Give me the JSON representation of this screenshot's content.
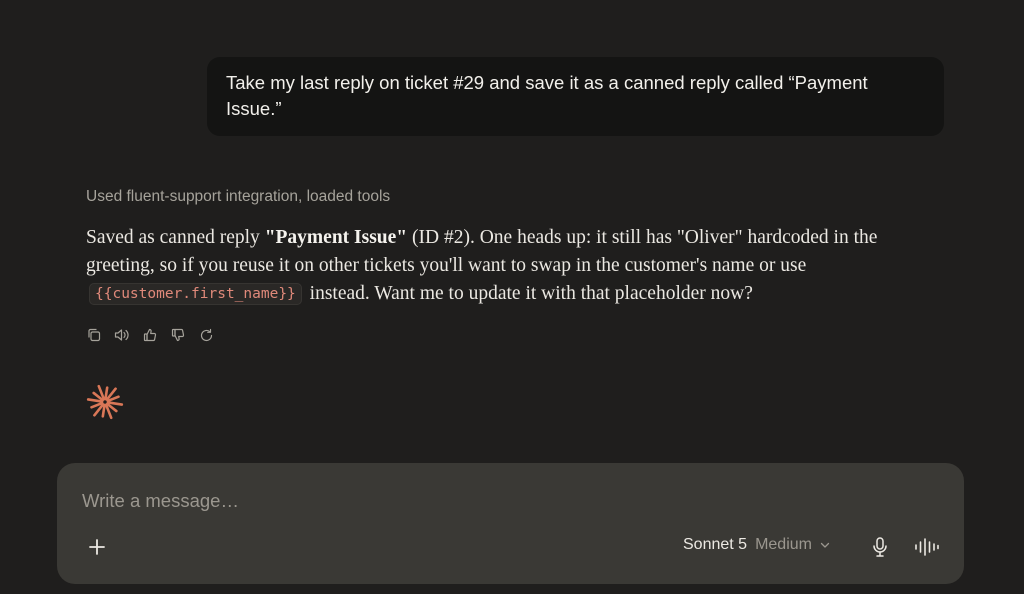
{
  "user_message": {
    "text": "Take my last reply on ticket #29 and save it as a canned reply called “Payment Issue.”"
  },
  "assistant": {
    "tool_status": "Used fluent-support integration, loaded tools",
    "text_parts": {
      "p1": "Saved as canned reply ",
      "bold": "\"Payment Issue\"",
      "p2": " (ID #2). One heads up: it still has \"Oliver\" hardcoded in the greeting, so if you reuse it on other tickets you'll want to swap in the customer's name or use ",
      "code": "{{customer.first_name}}",
      "p3": " instead. Want me to update it with that placeholder now?"
    },
    "actions": [
      "copy-icon",
      "speaker-icon",
      "thumbs-up-icon",
      "thumbs-down-icon",
      "retry-icon"
    ]
  },
  "composer": {
    "placeholder": "Write a message…",
    "model_name": "Sonnet 5",
    "model_level": "Medium"
  },
  "colors": {
    "background": "#1f1e1d",
    "bubble": "#141413",
    "composer": "#3a3935",
    "accent": "#d97757",
    "code_text": "#e0897a"
  }
}
